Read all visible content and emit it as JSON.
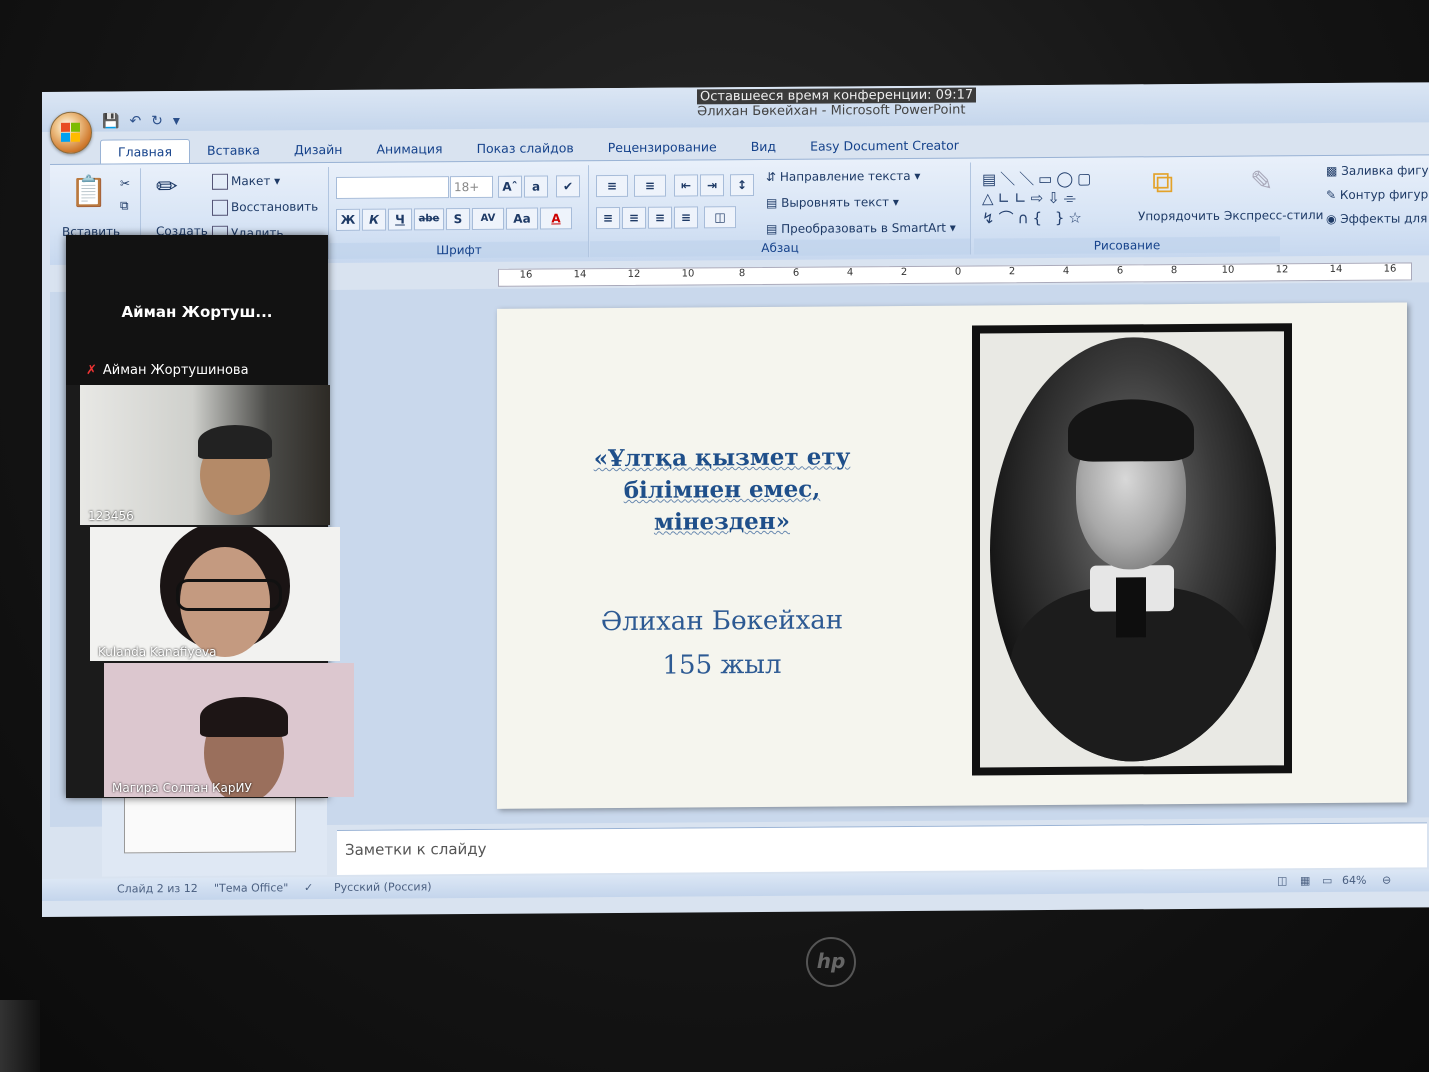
{
  "window": {
    "conference_timer": "Оставшееся время конференции: 09:17",
    "app_title": "Әлихан Бөкейхан - Microsoft PowerPoint"
  },
  "tabs": [
    "Главная",
    "Вставка",
    "Дизайн",
    "Анимация",
    "Показ слайдов",
    "Рецензирование",
    "Вид",
    "Easy Document Creator"
  ],
  "ribbon": {
    "clipboard": {
      "paste": "Вставить"
    },
    "slides": {
      "create": "Создать",
      "layout": "Макет",
      "reset": "Восстановить",
      "delete": "Удалить"
    },
    "font": {
      "label": "Шрифт",
      "size": "18+",
      "bold": "Ж",
      "italic": "К",
      "underline": "Ч",
      "strike": "abe",
      "shadow": "S",
      "spacing": "AV",
      "case": "Aa",
      "color": "A"
    },
    "paragraph": {
      "label": "Абзац",
      "text_direction": "Направление текста",
      "align_text": "Выровнять текст",
      "smartart": "Преобразовать в SmartArt"
    },
    "drawing": {
      "label": "Рисование",
      "arrange": "Упорядочить",
      "quick_styles": "Экспресс-стили",
      "shape_fill": "Заливка фигу",
      "shape_outline": "Контур фигура",
      "shape_effects": "Эффекты для"
    }
  },
  "ruler": [
    "16",
    "14",
    "12",
    "10",
    "8",
    "6",
    "4",
    "2",
    "0",
    "2",
    "4",
    "6",
    "8",
    "10",
    "12",
    "14",
    "16"
  ],
  "slide": {
    "quote_line1": "«Ұлтқа қызмет ету",
    "quote_line2": "білімнен емес,",
    "quote_line3": "мінезден»",
    "name": "Әлихан Бөкейхан",
    "years": "155 жыл"
  },
  "notes_placeholder": "Заметки к слайду",
  "status": {
    "slide_position": "Слайд 2 из 12",
    "theme": "\"Тема Office\"",
    "language": "Русский (Россия)",
    "zoom": "64%"
  },
  "conference": {
    "speaker_title": "Айман Жортуш...",
    "speaker_name": "Айман Жортушинова",
    "participants": [
      "123456",
      "Kulanda Kanafiyeva",
      "Магира Солтан КарИУ"
    ]
  },
  "laptop": {
    "brand": "hp"
  }
}
